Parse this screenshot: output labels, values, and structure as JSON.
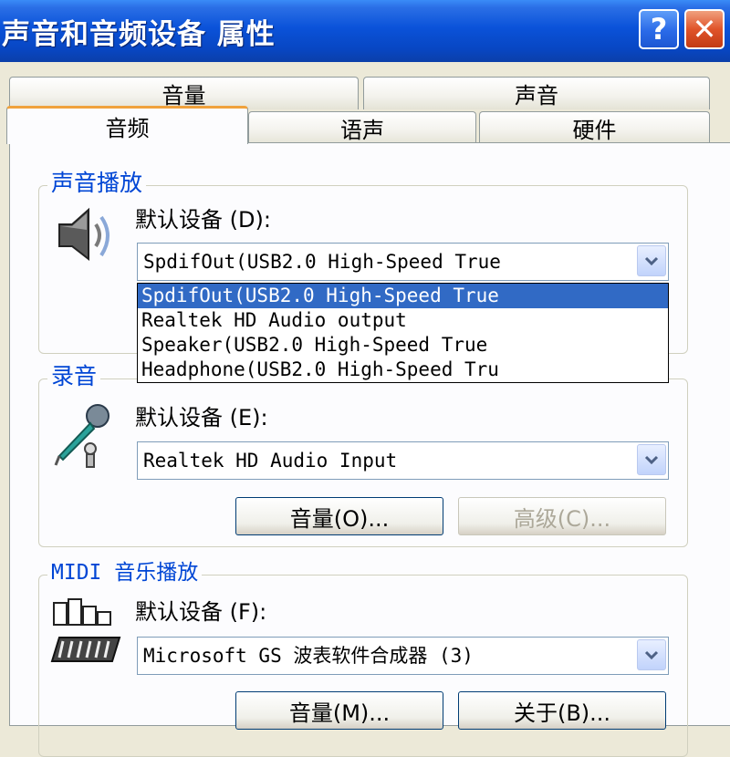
{
  "window": {
    "title": "声音和音频设备 属性",
    "help_glyph": "?",
    "close_glyph": "✕"
  },
  "tabs": {
    "row_back": [
      "音量",
      "声音"
    ],
    "row_front": [
      "音频",
      "语声",
      "硬件"
    ],
    "active": "音频"
  },
  "playback": {
    "legend": "声音播放",
    "default_label": "默认设备 (D):",
    "selected": "SpdifOut(USB2.0 High-Speed True",
    "options": [
      "SpdifOut(USB2.0 High-Speed True",
      "Realtek HD Audio output",
      "Speaker(USB2.0 High-Speed True",
      "Headphone(USB2.0 High-Speed Tru"
    ]
  },
  "recording": {
    "legend": "录音",
    "default_label": "默认设备 (E):",
    "selected": "Realtek HD Audio Input",
    "volume_button": "音量(O)...",
    "advanced_button": "高级(C)..."
  },
  "midi": {
    "legend": "MIDI 音乐播放",
    "default_label": "默认设备 (F):",
    "selected": "Microsoft GS 波表软件合成器 (3)",
    "volume_button": "音量(M)...",
    "about_button": "关于(B)..."
  },
  "colors": {
    "titlebar": "#0a52d9",
    "legend_text": "#0046d5",
    "selection": "#316ac5",
    "active_tab_accent": "#f0a23c"
  }
}
